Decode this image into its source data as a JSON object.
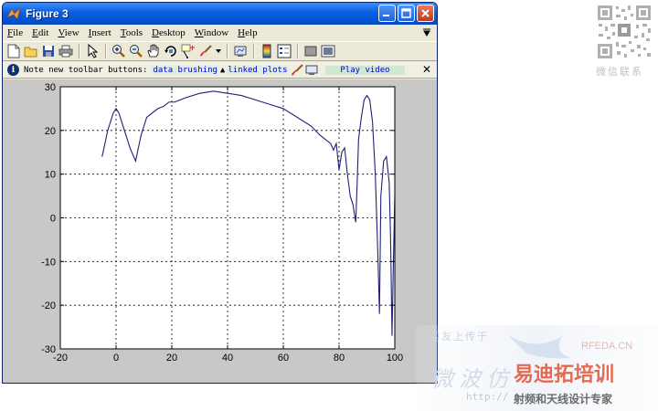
{
  "window": {
    "title": "Figure 3"
  },
  "menu": {
    "items": [
      {
        "label": "File"
      },
      {
        "label": "Edit"
      },
      {
        "label": "View"
      },
      {
        "label": "Insert"
      },
      {
        "label": "Tools"
      },
      {
        "label": "Desktop"
      },
      {
        "label": "Window"
      },
      {
        "label": "Help"
      }
    ]
  },
  "toolbar": {
    "icons": [
      "new-figure-icon",
      "open-file-icon",
      "save-icon",
      "print-icon",
      "edit-plot-arrow-icon",
      "zoom-in-icon",
      "zoom-out-icon",
      "pan-hand-icon",
      "rotate-3d-icon",
      "data-cursor-icon",
      "brush-icon",
      "link-plot-icon",
      "colorbar-icon",
      "legend-icon",
      "hide-plot-tools-icon",
      "show-plot-tools-icon"
    ]
  },
  "infobar": {
    "prefix": "Note new toolbar buttons:",
    "brushing": "data brushing",
    "linked": "linked plots",
    "play": "Play video",
    "close": "✕"
  },
  "chart_data": {
    "type": "line",
    "xlim": [
      -20,
      100
    ],
    "ylim": [
      -30,
      30
    ],
    "xticks": [
      -20,
      0,
      20,
      40,
      60,
      80,
      100
    ],
    "yticks": [
      -30,
      -20,
      -10,
      0,
      10,
      20,
      30
    ],
    "grid": true,
    "line_color": "#1f1f7a",
    "x": [
      -5,
      -3,
      -1,
      0,
      1,
      3,
      5,
      7,
      9,
      11,
      13,
      15,
      17,
      19,
      21,
      25,
      30,
      35,
      40,
      45,
      50,
      55,
      60,
      65,
      70,
      73,
      75,
      77,
      78,
      79,
      80,
      81,
      82,
      83,
      84,
      85,
      86,
      86.5,
      87,
      88,
      89,
      90,
      91,
      92,
      93,
      94,
      94.5,
      95,
      96,
      97,
      98,
      98.5,
      99,
      99.5,
      100
    ],
    "y": [
      14,
      20,
      24,
      25,
      24,
      20,
      16,
      13,
      19,
      23,
      24,
      25,
      25.5,
      26.5,
      26.5,
      27.5,
      28.5,
      29,
      28.5,
      28,
      27,
      26,
      25,
      23,
      21,
      19,
      18,
      17,
      15.5,
      17,
      11,
      15,
      16,
      10,
      5,
      3,
      -1,
      8,
      18,
      23,
      27,
      28,
      27,
      22,
      10,
      -10,
      -22,
      5,
      13,
      14,
      8,
      -5,
      -27,
      -10,
      5
    ]
  },
  "watermarks": {
    "qr_caption": "微信联系",
    "line1": "网友上传于",
    "big": "微波仿",
    "rfeda": "RFEDA.CN",
    "train": "易迪拓培训",
    "url": "http://",
    "slogan": "射频和天线设计专家"
  }
}
